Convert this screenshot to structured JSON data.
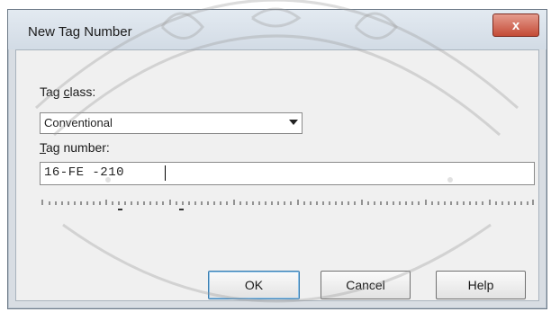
{
  "window": {
    "title": "New Tag Number",
    "close_label": "x"
  },
  "form": {
    "tag_class_label_prefix": "Tag ",
    "tag_class_label_accel": "c",
    "tag_class_label_suffix": "lass:",
    "tag_class_value": "Conventional",
    "tag_number_label_accel": "T",
    "tag_number_label_suffix": "ag number:",
    "tag_number_value": "16-FE -210"
  },
  "buttons": {
    "ok_label": "OK",
    "cancel_label": "Cancel",
    "help_label": "Help"
  },
  "colors": {
    "close_button": "#c44b36",
    "dialog_frame": "#d8dde3",
    "client_area": "#f0f0f0"
  },
  "icons": {
    "dropdown": "chevron-down-icon",
    "watermark": "seal-watermark"
  }
}
